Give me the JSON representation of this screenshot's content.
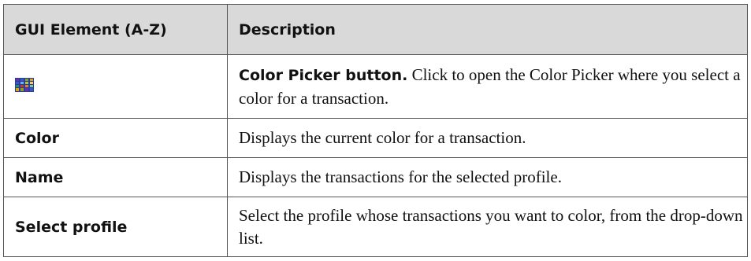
{
  "table": {
    "headers": [
      "GUI Element (A-Z)",
      "Description"
    ],
    "rows": [
      {
        "element_icon": "color-picker-icon",
        "element": "",
        "description_bold": "Color Picker button.",
        "description": " Click to open the Color Picker where you select a color for a transaction."
      },
      {
        "element": "Color",
        "description_bold": "",
        "description": "Displays the current color for a transaction."
      },
      {
        "element": "Name",
        "description_bold": "",
        "description": "Displays the transactions for the selected profile."
      },
      {
        "element": "Select profile",
        "description_bold": "",
        "description": "Select the profile whose transactions you want to color, from the drop-down list."
      }
    ]
  },
  "colors": {
    "header_bg": "#d9d9d9",
    "border": "#555555",
    "icon_palette": [
      "#3a56c8",
      "#6a2fae",
      "#8a9c2c",
      "#d8a21f",
      "#2f8a6a",
      "#c43a2a"
    ]
  }
}
